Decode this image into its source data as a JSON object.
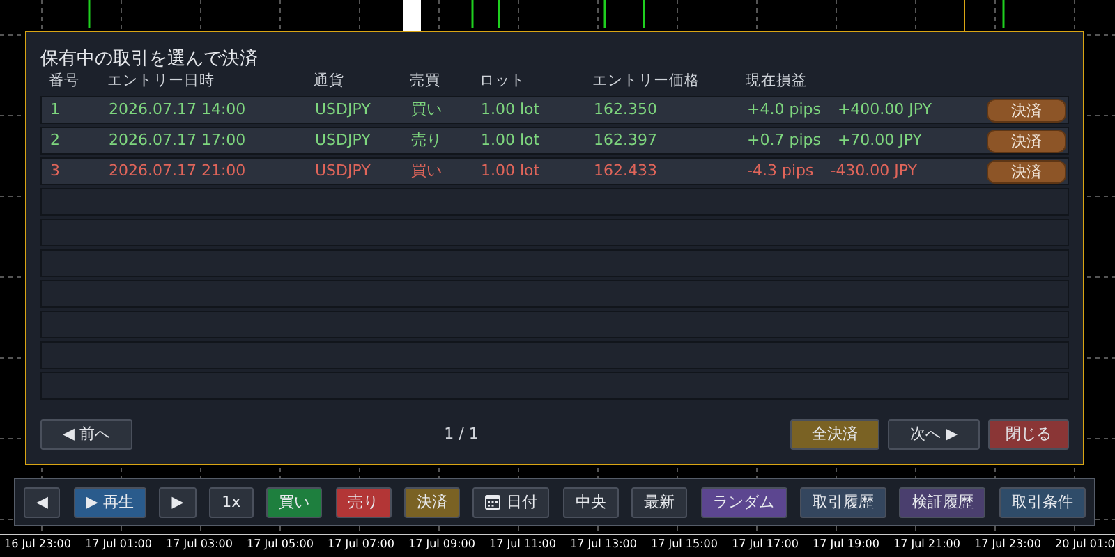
{
  "dialog": {
    "title": "保有中の取引を選んで決済",
    "columns": [
      "番号",
      "エントリー日時",
      "通貨",
      "売買",
      "ロット",
      "エントリー価格",
      "現在損益"
    ],
    "rows": [
      {
        "no": "1",
        "datetime": "2026.07.17 14:00",
        "currency": "USDJPY",
        "side": "買い",
        "lot": "1.00 lot",
        "price": "162.350",
        "pips": "+4.0 pips",
        "profit": "+400.00 JPY",
        "color": "#7ed67e",
        "action": "決済"
      },
      {
        "no": "2",
        "datetime": "2026.07.17 17:00",
        "currency": "USDJPY",
        "side": "売り",
        "lot": "1.00 lot",
        "price": "162.397",
        "pips": "+0.7 pips",
        "profit": "+70.00 JPY",
        "color": "#7ed67e",
        "action": "決済"
      },
      {
        "no": "3",
        "datetime": "2026.07.17 21:00",
        "currency": "USDJPY",
        "side": "買い",
        "lot": "1.00 lot",
        "price": "162.433",
        "pips": "-4.3 pips",
        "profit": "-430.00 JPY",
        "color": "#e0655a",
        "action": "決済"
      }
    ],
    "prev": {
      "icon": "◀",
      "label": "前へ"
    },
    "page": "1 / 1",
    "close_all": "全決済",
    "next": {
      "label": "次へ",
      "icon": "▶"
    },
    "close": "閉じる"
  },
  "toolbar": [
    {
      "kind": "text",
      "label": "◀",
      "color": "#2c323c"
    },
    {
      "kind": "text",
      "icon": "▶",
      "label": "再生",
      "color": "#2a5b8c"
    },
    {
      "kind": "text",
      "label": "▶",
      "color": "#2c323c"
    },
    {
      "kind": "text",
      "label": "1x",
      "color": "#2c323c"
    },
    {
      "kind": "text",
      "label": "買い",
      "color": "#1e7f3e"
    },
    {
      "kind": "text",
      "label": "売り",
      "color": "#b33636"
    },
    {
      "kind": "text",
      "label": "決済",
      "color": "#7a6224"
    },
    {
      "kind": "calendar",
      "label": "日付",
      "color": "#2c323c"
    },
    {
      "kind": "text",
      "label": "中央",
      "color": "#2c323c"
    },
    {
      "kind": "text",
      "label": "最新",
      "color": "#2c323c"
    },
    {
      "kind": "text",
      "label": "ランダム",
      "color": "#5c4690"
    },
    {
      "kind": "text",
      "label": "取引履歴",
      "color": "#34465e"
    },
    {
      "kind": "text",
      "label": "検証履歴",
      "color": "#4a3f6e"
    },
    {
      "kind": "text",
      "label": "取引条件",
      "color": "#2f4c69"
    }
  ],
  "time_axis": [
    "16 Jul 23:00",
    "17 Jul 01:00",
    "17 Jul 03:00",
    "17 Jul 05:00",
    "17 Jul 07:00",
    "17 Jul 09:00",
    "17 Jul 11:00",
    "17 Jul 13:00",
    "17 Jul 15:00",
    "17 Jul 17:00",
    "17 Jul 19:00",
    "17 Jul 21:00",
    "17 Jul 23:00",
    "20 Jul 01:0"
  ]
}
